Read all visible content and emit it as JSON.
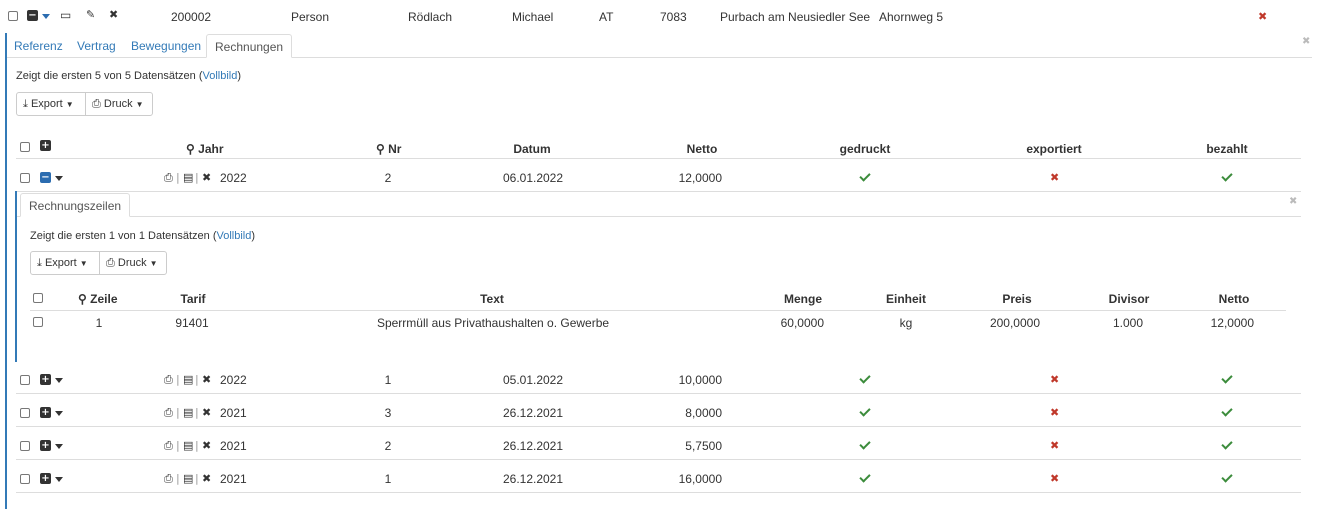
{
  "top_row": {
    "id": "200002",
    "type": "Person",
    "last_name": "Rödlach",
    "first_name": "Michael",
    "country": "AT",
    "zip": "7083",
    "city": "Purbach am Neusiedler See",
    "street": "Ahornweg 5"
  },
  "outer_tabs": [
    "Referenz",
    "Vertrag",
    "Bewegungen",
    "Rechnungen"
  ],
  "outer_info": {
    "prefix": "Zeigt die ersten 5 von 5 Datensätzen (",
    "link": "Vollbild",
    "suffix": ")"
  },
  "buttons": {
    "export": "Export",
    "print": "Druck"
  },
  "invoice_table": {
    "headers": {
      "jahr": "Jahr",
      "nr": "Nr",
      "datum": "Datum",
      "netto": "Netto",
      "gedruckt": "gedruckt",
      "exportiert": "exportiert",
      "bezahlt": "bezahlt"
    },
    "rows": [
      {
        "jahr": "2022",
        "nr": "2",
        "datum": "06.01.2022",
        "netto": "12,0000",
        "gedruckt": true,
        "exportiert": false,
        "bezahlt": true
      },
      {
        "jahr": "2022",
        "nr": "1",
        "datum": "05.01.2022",
        "netto": "10,0000",
        "gedruckt": true,
        "exportiert": false,
        "bezahlt": true
      },
      {
        "jahr": "2021",
        "nr": "3",
        "datum": "26.12.2021",
        "netto": "8,0000",
        "gedruckt": true,
        "exportiert": false,
        "bezahlt": true
      },
      {
        "jahr": "2021",
        "nr": "2",
        "datum": "26.12.2021",
        "netto": "5,7500",
        "gedruckt": true,
        "exportiert": false,
        "bezahlt": true
      },
      {
        "jahr": "2021",
        "nr": "1",
        "datum": "26.12.2021",
        "netto": "16,0000",
        "gedruckt": true,
        "exportiert": false,
        "bezahlt": true
      }
    ]
  },
  "inner_tab": "Rechnungszeilen",
  "inner_info": {
    "prefix": "Zeigt die ersten 1 von 1 Datensätzen (",
    "link": "Vollbild",
    "suffix": ")"
  },
  "lines_table": {
    "headers": {
      "zeile": "Zeile",
      "tarif": "Tarif",
      "text": "Text",
      "menge": "Menge",
      "einheit": "Einheit",
      "preis": "Preis",
      "divisor": "Divisor",
      "netto": "Netto"
    },
    "rows": [
      {
        "zeile": "1",
        "tarif": "91401",
        "text": "Sperrmüll aus Privathaushalten o. Gewerbe",
        "menge": "60,0000",
        "einheit": "kg",
        "preis": "200,0000",
        "divisor": "1.000",
        "netto": "12,0000"
      }
    ]
  },
  "colors": {
    "link": "#337ab7",
    "check": "#3c8c3c",
    "cross": "#c0392b"
  }
}
